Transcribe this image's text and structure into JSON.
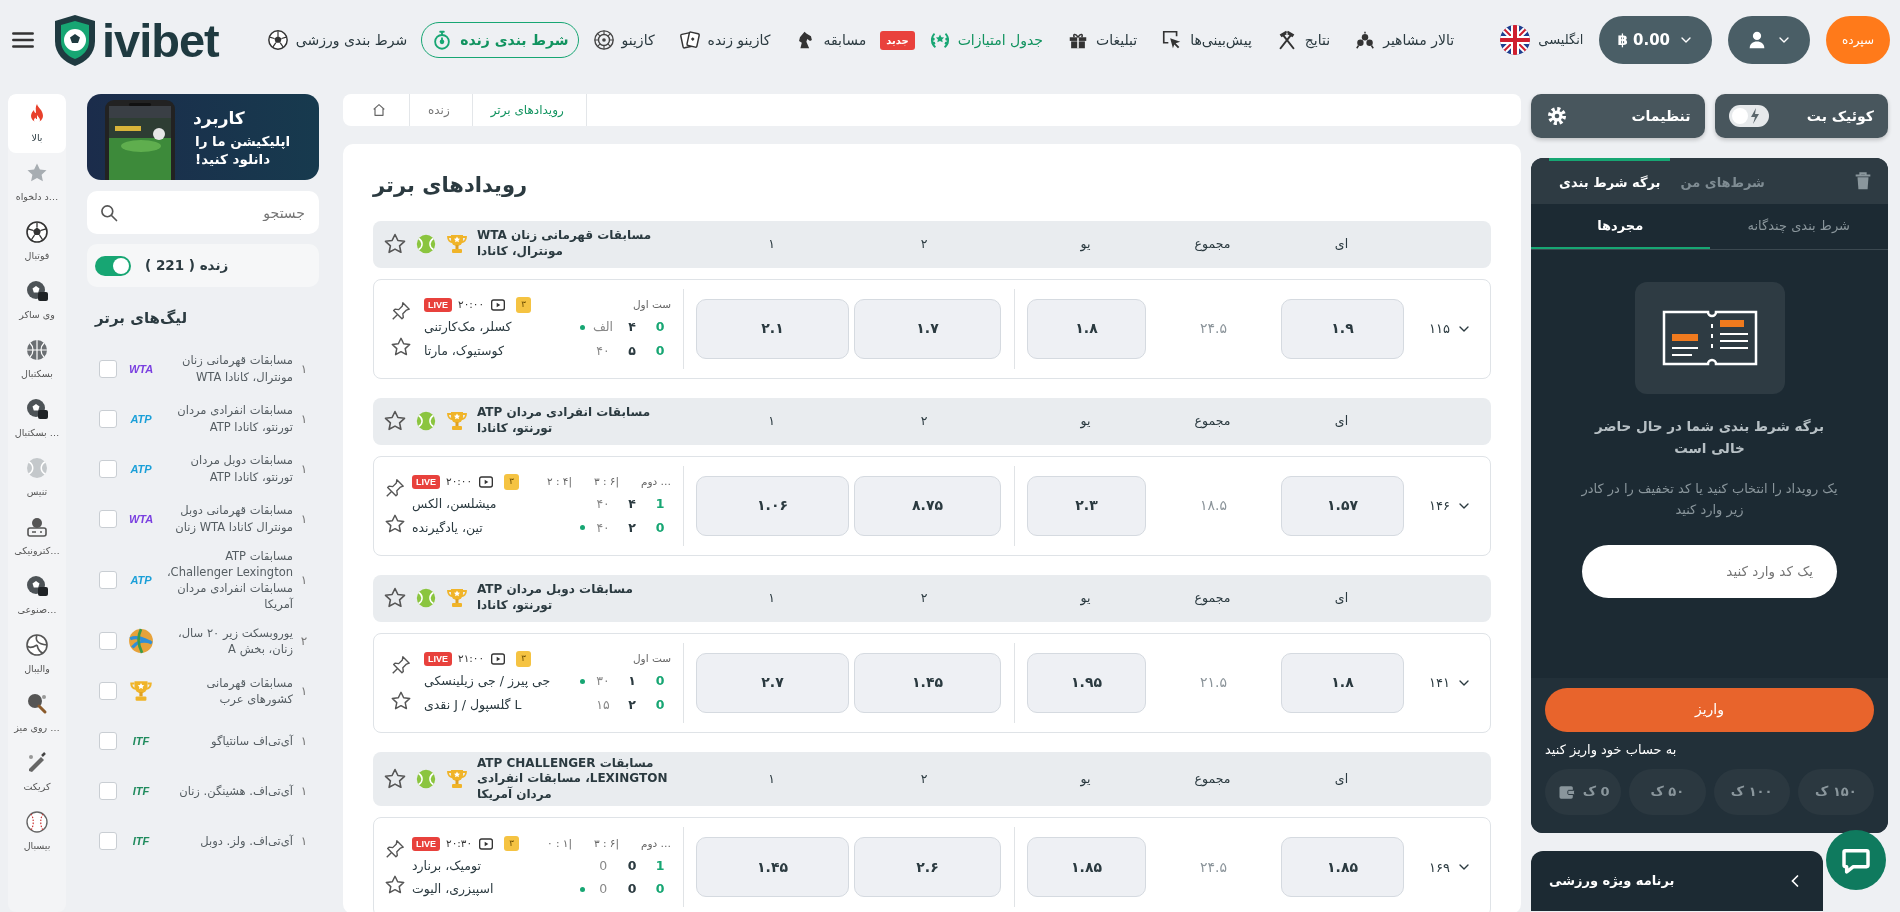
{
  "header": {
    "logo": "ivibet",
    "nav": [
      {
        "label": "تالار مشاهیر",
        "selected": false
      },
      {
        "label": "نتایج",
        "selected": false
      },
      {
        "label": "پیش‌بینی‌ها",
        "selected": false
      },
      {
        "label": "تبلیغات",
        "selected": false
      },
      {
        "label": "جدول امتیازات",
        "selected": false,
        "badge": "جدید",
        "highlight": true
      },
      {
        "label": "مسابقه",
        "selected": false
      },
      {
        "label": "کازینو زنده",
        "selected": false
      },
      {
        "label": "کازینو",
        "selected": false
      },
      {
        "label": "شرط بندی زنده",
        "selected": true
      },
      {
        "label": "شرط بندی ورزشی",
        "selected": false
      }
    ],
    "language": "انگلیسی",
    "balance": "฿ 0.00",
    "deposit": "سپرده"
  },
  "sports": [
    {
      "label": "بالا",
      "selected": true
    },
    {
      "label": "…د دلخواه",
      "selected": false
    },
    {
      "label": "فوتبال",
      "selected": false
    },
    {
      "label": "وی ساکر",
      "selected": false
    },
    {
      "label": "بسکتبال",
      "selected": false
    },
    {
      "label": "… بسکتبال",
      "selected": false
    },
    {
      "label": "تنیس",
      "selected": false
    },
    {
      "label": "…کترونیکی",
      "selected": false
    },
    {
      "label": "…صنوعی",
      "selected": false
    },
    {
      "label": "والیبال",
      "selected": false
    },
    {
      "label": "… روی میز",
      "selected": false
    },
    {
      "label": "کریکت",
      "selected": false
    },
    {
      "label": "بیسبال",
      "selected": false
    }
  ],
  "app_banner": {
    "title": "کاربرد",
    "text": "اپلیکیشن ما را دانلود کنید!"
  },
  "search": {
    "placeholder": "جستجو"
  },
  "live_filter": {
    "label": "زنده ( 221 )",
    "on": true
  },
  "leagues": {
    "title": "لیگ‌های برتر",
    "items": [
      {
        "count": "۱",
        "name": "مسابقات قهرمانی زنان مونترال، کانادا WTA",
        "checked": false,
        "logo": {
          "kind": "wordmark",
          "text": "WTA",
          "color": "#7a3fe0"
        }
      },
      {
        "count": "۱",
        "name": "مسابقات انفرادی مردان تورنتو، کانادا ATP",
        "checked": false,
        "logo": {
          "kind": "wordmark",
          "text": "ATP",
          "color": "#1a9fd8"
        }
      },
      {
        "count": "۱",
        "name": "مسابقات دوبل مردان تورنتو، کانادا ATP",
        "checked": false,
        "logo": {
          "kind": "wordmark",
          "text": "ATP",
          "color": "#1a9fd8"
        }
      },
      {
        "count": "۱",
        "name": "مسابقات قهرمانی دوبل مونترال کانادا WTA زنان",
        "checked": false,
        "logo": {
          "kind": "wordmark",
          "text": "WTA",
          "color": "#7a3fe0"
        }
      },
      {
        "count": "۱",
        "name": "مسابقات ATP Challenger Lexington، مسابقات انفرادی مردان آمریکا",
        "checked": false,
        "logo": {
          "kind": "wordmark",
          "text": "ATP",
          "color": "#1a9fd8"
        }
      },
      {
        "count": "۲",
        "name": "یوروبسکت زیر ۲۰ سال، زنان، بخش A",
        "checked": false,
        "logo": {
          "kind": "ball"
        }
      },
      {
        "count": "۱",
        "name": "مسابقات قهرمانی کشورهای عرب",
        "checked": false,
        "logo": {
          "kind": "trophy"
        }
      },
      {
        "count": "۱",
        "name": "آی‌تی‌اف سانتیاگو",
        "checked": false,
        "logo": {
          "kind": "wordmark",
          "text": "ITF",
          "color": "#1e8a5c"
        }
      },
      {
        "count": "۱",
        "name": "آی‌تی‌اف. هشینگن. زنان",
        "checked": false,
        "logo": {
          "kind": "wordmark",
          "text": "ITF",
          "color": "#1e8a5c"
        }
      },
      {
        "count": "۱",
        "name": "آی‌تی‌اف. ولز. دوبل",
        "checked": false,
        "logo": {
          "kind": "wordmark",
          "text": "ITF",
          "color": "#1e8a5c"
        }
      }
    ]
  },
  "breadcrumb": [
    {
      "kind": "link",
      "label": "رویدادهای برتر",
      "selected": true
    },
    {
      "kind": "link",
      "label": "زنده",
      "selected": false
    },
    {
      "kind": "home",
      "selected": false
    }
  ],
  "events": {
    "title": "رویدادهای برتر",
    "groups": [
      {
        "league": "مسابقات قهرمانی زنان WTA مونترال، کانادا",
        "columns": [
          "ای",
          "مجموع",
          "یو",
          "۲",
          "۱"
        ],
        "match": {
          "period": "ست اول",
          "badge": "۳",
          "time": "۲۰:۰۰",
          "live": "LIVE",
          "teams": [
            {
              "name": "کسلر، مک‌کارتنی",
              "points": "الف",
              "games": "۴",
              "sets": "0",
              "serving": true
            },
            {
              "name": "کوستیوک، مارتا",
              "points": "۴۰",
              "games": "۵",
              "sets": "0",
              "serving": false
            }
          ],
          "odds": [
            {
              "kind": "button",
              "value": "۱.۹"
            },
            {
              "kind": "plain",
              "value": "۲۴.۵"
            },
            {
              "kind": "button",
              "value": "۱.۸"
            },
            {
              "kind": "button",
              "value": "۱.۷"
            },
            {
              "kind": "button",
              "value": "۲.۱"
            }
          ],
          "markets": "۱۱۵"
        }
      },
      {
        "league": "مسابقات انفرادی مردان ATP تورنتو، کانادا",
        "columns": [
          "ای",
          "مجموع",
          "یو",
          "۲",
          "۱"
        ],
        "match": {
          "period": "… دوم",
          "set_scores": [
            "۳ : ۶|",
            "۲ : ۴|"
          ],
          "badge": "۳",
          "time": "۲۰:۰۰",
          "live": "LIVE",
          "teams": [
            {
              "name": "میشلسن، الکس",
              "points": "۴۰",
              "games": "۴",
              "sets": "1",
              "serving": false
            },
            {
              "name": "تین، یادگیرنده",
              "points": "۴۰",
              "games": "۲",
              "sets": "0",
              "serving": true
            }
          ],
          "odds": [
            {
              "kind": "button",
              "value": "۱.۵۷"
            },
            {
              "kind": "plain",
              "value": "۱۸.۵"
            },
            {
              "kind": "button",
              "value": "۲.۳"
            },
            {
              "kind": "button",
              "value": "۸.۷۵"
            },
            {
              "kind": "button",
              "value": "۱.۰۶"
            }
          ],
          "markets": "۱۴۶"
        }
      },
      {
        "league": "مسابقات دوبل مردان ATP تورنتو، کانادا",
        "columns": [
          "ای",
          "مجموع",
          "یو",
          "۲",
          "۱"
        ],
        "match": {
          "period": "ست اول",
          "badge": "۳",
          "time": "۲۱:۰۰",
          "live": "LIVE",
          "teams": [
            {
              "name": "جی پیرز / جی زیلینسکی",
              "points": "۳۰",
              "games": "۱",
              "sets": "0",
              "serving": true
            },
            {
              "name": "L گلسپول / J نقدی",
              "points": "۱۵",
              "games": "۲",
              "sets": "0",
              "serving": false
            }
          ],
          "odds": [
            {
              "kind": "button",
              "value": "۱.۸"
            },
            {
              "kind": "plain",
              "value": "۲۱.۵"
            },
            {
              "kind": "button",
              "value": "۱.۹۵"
            },
            {
              "kind": "button",
              "value": "۱.۴۵"
            },
            {
              "kind": "button",
              "value": "۲.۷"
            }
          ],
          "markets": "۱۴۱"
        }
      },
      {
        "league": "مسابقات ATP CHALLENGER LEXINGTON، مسابقات انفرادی مردان آمریکا",
        "columns": [
          "ای",
          "مجموع",
          "یو",
          "۲",
          "۱"
        ],
        "match": {
          "period": "… دوم",
          "set_scores": [
            "۳ : ۶|",
            "۰ : ۱|"
          ],
          "badge": "۳",
          "time": "۲۰:۳۰",
          "live": "LIVE",
          "teams": [
            {
              "name": "تومیک، برنارد",
              "points": "0",
              "games": "0",
              "sets": "1",
              "serving": false
            },
            {
              "name": "اسپیزری، الیوت",
              "points": "0",
              "games": "0",
              "sets": "0",
              "serving": true
            }
          ],
          "odds": [
            {
              "kind": "button",
              "value": "۱.۸۵"
            },
            {
              "kind": "plain",
              "value": "۲۴.۵"
            },
            {
              "kind": "button",
              "value": "۱.۸۵"
            },
            {
              "kind": "button",
              "value": "۲.۶"
            },
            {
              "kind": "button",
              "value": "۱.۴۵"
            }
          ],
          "markets": "۱۶۹"
        }
      }
    ]
  },
  "bet_panel": {
    "settings": "تنظیمات",
    "quick_bet": {
      "label": "کوئیک بت",
      "on": false
    },
    "tabs": [
      {
        "label": "شرط‌های من",
        "selected": false
      },
      {
        "label": "برگه شرط بندی",
        "selected": true
      }
    ],
    "subtabs": [
      {
        "label": "شرط بندی چندگانه",
        "selected": false
      },
      {
        "label": "مجردها",
        "selected": true
      }
    ],
    "empty_title": "برگه شرط بندی شما در حال حاضر خالی است",
    "empty_text": "یک رویداد را انتخاب کنید یا کد تخفیف را در کادر زیر وارد کنید",
    "code": {
      "placeholder": "یک کد وارد کنید"
    },
    "deposit_button": "واریز",
    "deposit_text": "به حساب خود واریز کنید",
    "amounts": [
      {
        "kind": "plain",
        "label": "۱۵۰ ک"
      },
      {
        "kind": "plain",
        "label": "۱۰۰ ک"
      },
      {
        "kind": "plain",
        "label": "۵۰ ک"
      },
      {
        "kind": "wallet",
        "label": "0 ک"
      }
    ]
  },
  "special_program": "برنامه ویژه ورزشی"
}
